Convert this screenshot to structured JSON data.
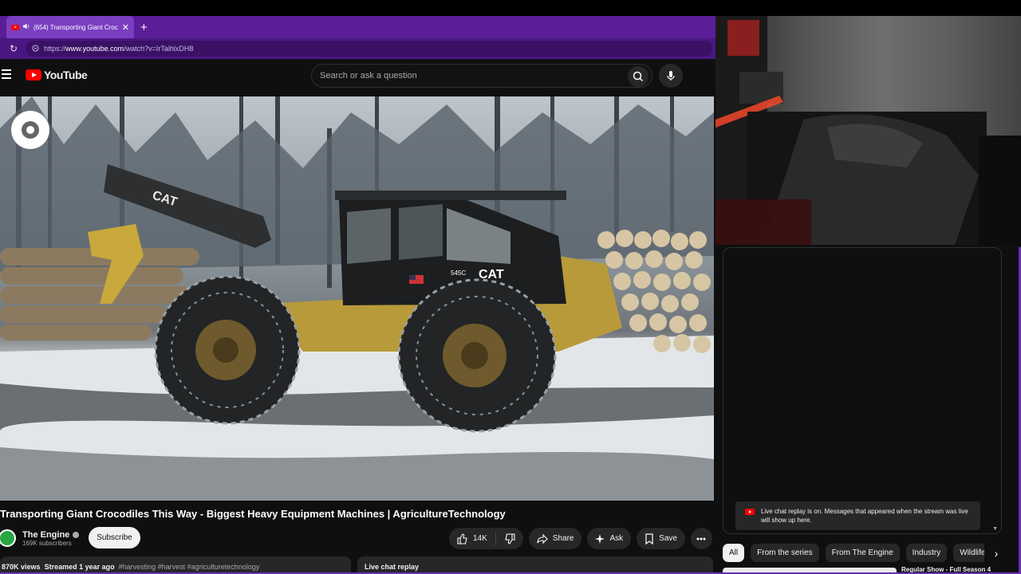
{
  "browser": {
    "tab_title": "(654) Transporting Giant Croc",
    "new_tab": "+",
    "tab_close": "✕",
    "url_prefix": "https://",
    "url_host": "www.youtube.com",
    "url_path": "/watch?v=IrTalhlxDH8"
  },
  "header": {
    "logo_text": "YouTube",
    "search_placeholder": "Search or ask a question"
  },
  "video": {
    "title": "Transporting Giant Crocodiles This Way - Biggest Heavy Equipment Machines | AgricultureTechnology",
    "scene_text": {
      "boom_label": "CAT",
      "cab_label": "CAT",
      "model": "545C"
    }
  },
  "channel": {
    "name": "The Engine",
    "subscribers": "169K subscribers",
    "subscribe_label": "Subscribe"
  },
  "actions": {
    "likes": "14K",
    "share": "Share",
    "ask": "Ask",
    "save": "Save"
  },
  "description": {
    "views": "870K views",
    "streamed": "Streamed 1 year ago",
    "tags": "#harvesting #harvest #agriculturetechnology"
  },
  "chat": {
    "replay_label": "Live chat replay",
    "note": "Live chat replay is on. Messages that appeared when the stream was live will show up here."
  },
  "chips": [
    "All",
    "From the series",
    "From The Engine",
    "Industry",
    "Wildlife"
  ],
  "recommendation": {
    "title_peek": "Regular Show - Full Season 4"
  },
  "colors": {
    "browser_tab_bar": "#5b1e98",
    "youtube_red": "#ff0000",
    "page_bg": "#0f0f0f",
    "pill_bg": "#272727"
  }
}
